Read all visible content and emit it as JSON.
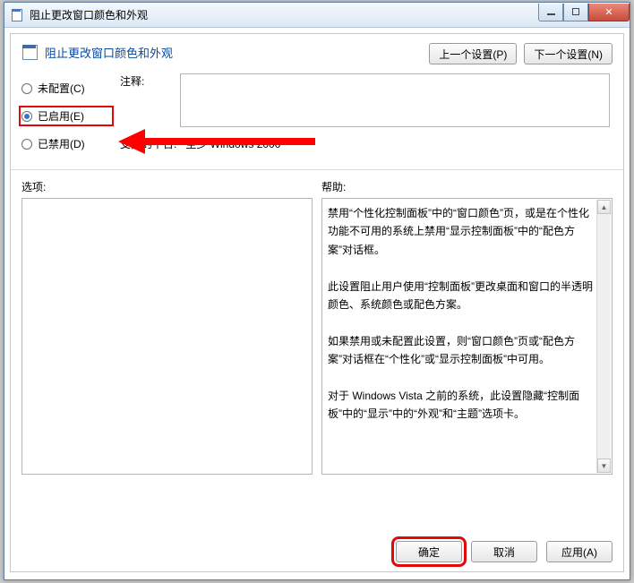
{
  "window": {
    "title": "阻止更改窗口颜色和外观"
  },
  "header": {
    "title": "阻止更改窗口颜色和外观",
    "prev_btn": "上一个设置(P)",
    "next_btn": "下一个设置(N)"
  },
  "radios": {
    "not_configured": "未配置(C)",
    "enabled": "已启用(E)",
    "disabled": "已禁用(D)",
    "selected": "enabled"
  },
  "labels": {
    "comment": "注释:",
    "platform": "支持的平台:",
    "options": "选项:",
    "help": "帮助:"
  },
  "platform_value": "至少 Windows 2000",
  "help_text": "禁用“个性化控制面板”中的“窗口颜色”页，或是在个性化功能不可用的系统上禁用“显示控制面板”中的“配色方案”对话框。\n\n此设置阻止用户使用“控制面板”更改桌面和窗口的半透明颜色、系统颜色或配色方案。\n\n如果禁用或未配置此设置，则“窗口颜色”页或“配色方案”对话框在“个性化”或“显示控制面板”中可用。\n\n对于 Windows Vista 之前的系统，此设置隐藏“控制面板”中的“显示”中的“外观”和“主题”选项卡。",
  "footer": {
    "ok": "确定",
    "cancel": "取消",
    "apply": "应用(A)"
  }
}
